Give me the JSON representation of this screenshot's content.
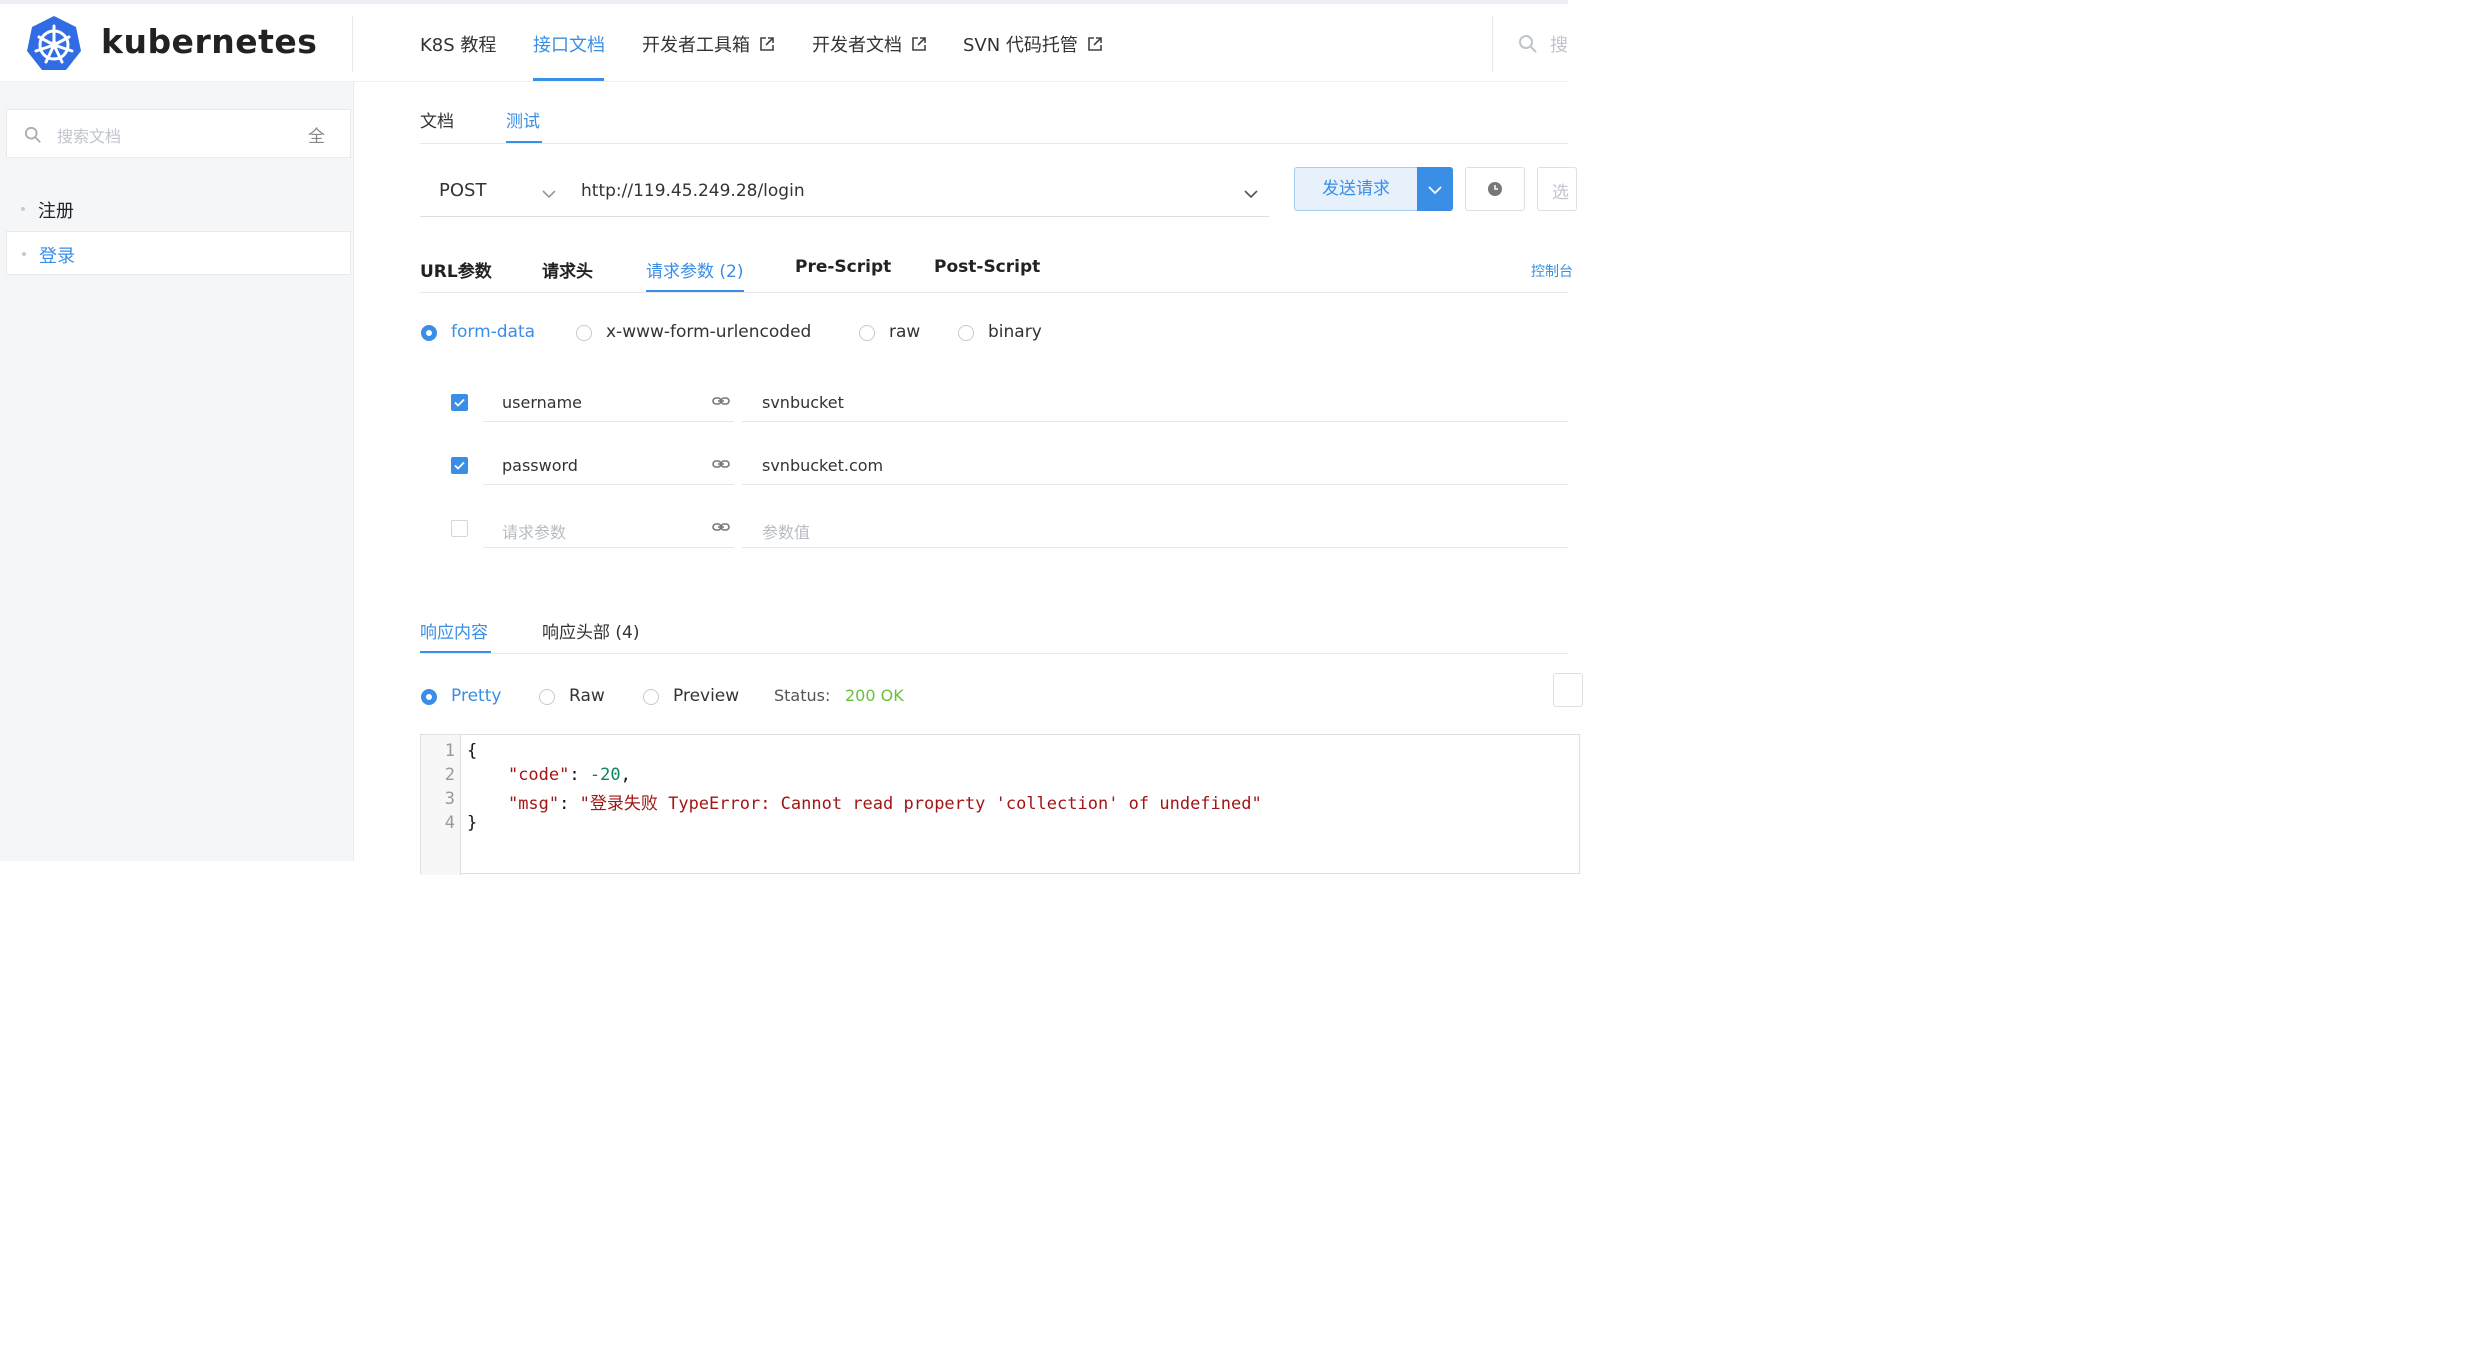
{
  "header": {
    "brand": "kubernetes",
    "nav": [
      {
        "label": "K8S 教程",
        "external": false,
        "active": false
      },
      {
        "label": "接口文档",
        "external": false,
        "active": true
      },
      {
        "label": "开发者工具箱",
        "external": true,
        "active": false
      },
      {
        "label": "开发者文档",
        "external": true,
        "active": false
      },
      {
        "label": "SVN 代码托管",
        "external": true,
        "active": false
      }
    ],
    "search_placeholder": "搜"
  },
  "sidebar": {
    "search_placeholder": "搜索文档",
    "search_scope": "全",
    "items": [
      {
        "label": "注册",
        "active": false
      },
      {
        "label": "登录",
        "active": true
      }
    ]
  },
  "main": {
    "tabs": [
      {
        "label": "文档",
        "active": false
      },
      {
        "label": "测试",
        "active": true
      }
    ],
    "request": {
      "method": "POST",
      "url": "http://119.45.249.28/login",
      "send_label": "发送请求",
      "more_label": "选"
    },
    "param_tabs": [
      {
        "label": "URL参数",
        "active": false
      },
      {
        "label": "请求头",
        "active": false
      },
      {
        "label": "请求参数 (2)",
        "active": true
      },
      {
        "label": "Pre-Script",
        "active": false
      },
      {
        "label": "Post-Script",
        "active": false
      }
    ],
    "console_link": "控制台",
    "body_types": [
      {
        "label": "form-data",
        "selected": true
      },
      {
        "label": "x-www-form-urlencoded",
        "selected": false
      },
      {
        "label": "raw",
        "selected": false
      },
      {
        "label": "binary",
        "selected": false
      }
    ],
    "params": [
      {
        "checked": true,
        "key": "username",
        "value": "svnbucket"
      },
      {
        "checked": true,
        "key": "password",
        "value": "svnbucket.com"
      },
      {
        "checked": false,
        "key_placeholder": "请求参数",
        "value_placeholder": "参数值"
      }
    ]
  },
  "response": {
    "tabs": [
      {
        "label": "响应内容",
        "active": true
      },
      {
        "label": "响应头部 (4)",
        "active": false
      }
    ],
    "views": [
      {
        "label": "Pretty",
        "selected": true
      },
      {
        "label": "Raw",
        "selected": false
      },
      {
        "label": "Preview",
        "selected": false
      }
    ],
    "status_label": "Status:",
    "status_value": "200 OK",
    "body": {
      "line_numbers": [
        "1",
        "2",
        "3",
        "4"
      ],
      "open": "{",
      "code_key": "\"code\"",
      "code_value": "-20",
      "msg_key": "\"msg\"",
      "msg_value": "\"登录失败 TypeError: Cannot read property 'collection' of undefined\"",
      "close": "}"
    }
  },
  "colors": {
    "accent": "#3a8ee6",
    "status_ok": "#67c23a",
    "json_string": "#a31515",
    "json_number": "#098658"
  }
}
